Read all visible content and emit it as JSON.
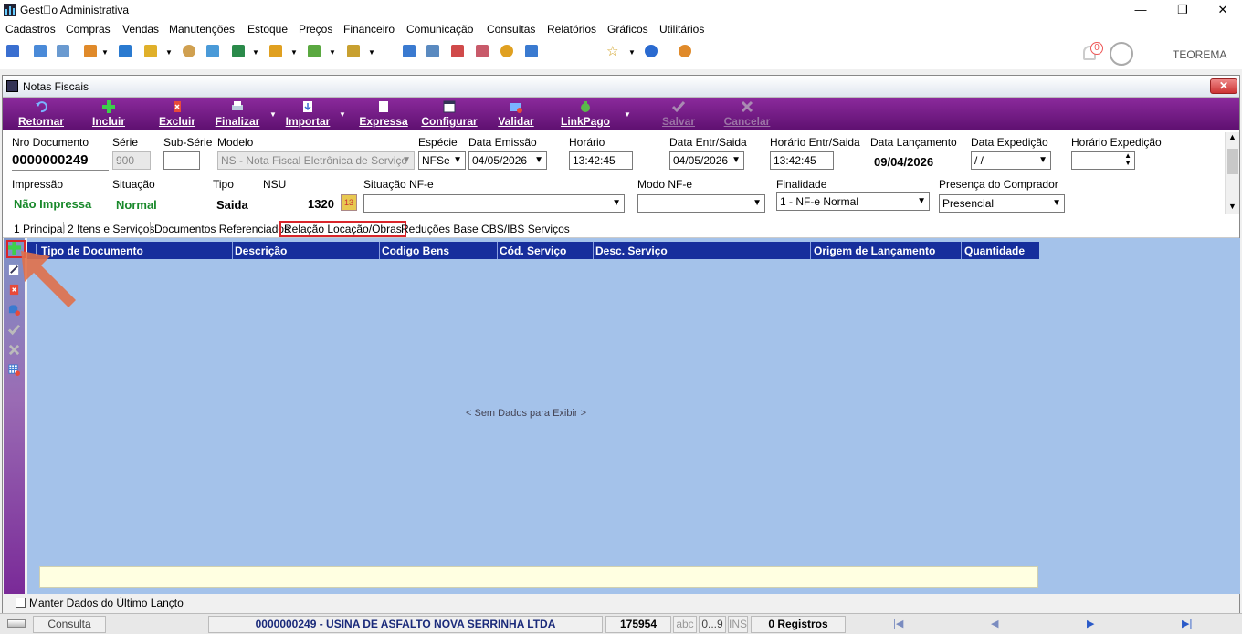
{
  "window": {
    "title": "Gest\u0000o Administrativa",
    "min": "—",
    "max": "❒",
    "close": "✕"
  },
  "menu": [
    "Cadastros",
    "Compras",
    "Vendas",
    "Manutenções",
    "Estoque",
    "Preços",
    "Financeiro",
    "Comunicação",
    "Consultas",
    "Relatórios",
    "Gráficos",
    "Utilitários"
  ],
  "header": {
    "notification_count": "0",
    "company": "TEOREMA"
  },
  "child": {
    "title": "Notas Fiscais",
    "close": "✕"
  },
  "actions": {
    "retornar": "Retornar",
    "incluir": "Incluir",
    "excluir": "Excluir",
    "finalizar": "Finalizar",
    "importar": "Importar",
    "expressa": "Expressa",
    "configurar": "Configurar",
    "validar": "Validar",
    "linkpago": "LinkPago",
    "salvar": "Salvar",
    "cancelar": "Cancelar"
  },
  "form": {
    "nro_label": "Nro Documento",
    "nro_value": "0000000249",
    "serie_label": "Série",
    "serie_value": "900",
    "subserie_label": "Sub-Série",
    "subserie_value": "",
    "modelo_label": "Modelo",
    "modelo_value": "NS - Nota Fiscal Eletrônica de Serviço",
    "especie_label": "Espécie",
    "especie_value": "NFSe",
    "emissao_label": "Data Emissão",
    "emissao_value": "04/05/2026",
    "horario_label": "Horário",
    "horario_value": "13:42:45",
    "entr_label": "Data Entr/Saida",
    "entr_value": "04/05/2026",
    "hentr_label": "Horário Entr/Saida",
    "hentr_value": "13:42:45",
    "lanc_label": "Data Lançamento",
    "lanc_value": "09/04/2026",
    "exped_label": "Data Expedição",
    "exped_value": " / /",
    "hexped_label": "Horário Expedição",
    "hexped_value": "",
    "impressao_label": "Impressão",
    "impressao_value": "Não Impressa",
    "situacao_label": "Situação",
    "situacao_value": "Normal",
    "tipo_label": "Tipo",
    "tipo_value": "Saida",
    "nsu_label": "NSU",
    "nsu_value": "1320",
    "sitnfe_label": "Situação NF-e",
    "sitnfe_value": "",
    "modonfe_label": "Modo NF-e",
    "modonfe_value": "",
    "finalidade_label": "Finalidade",
    "finalidade_value": "1 - NF-e Normal",
    "presenca_label": "Presença do Comprador",
    "presenca_value": "Presencial"
  },
  "tabs": [
    "1 Principal",
    "2 Itens e Serviços",
    "Documentos Referenciados",
    "Relação Locação/Obras",
    "Reduções Base CBS/IBS Serviços"
  ],
  "grid": {
    "columns": [
      "Tipo de Documento",
      "Descrição",
      "Codigo Bens",
      "Cód. Serviço",
      "Desc. Serviço",
      "Origem de Lançamento",
      "Quantidade"
    ],
    "empty": "< Sem Dados para Exibir >"
  },
  "manter": "Manter Dados do Último Lançto",
  "status": {
    "mode": "Consulta",
    "doc": "0000000249 - USINA DE ASFALTO NOVA SERRINHA LTDA",
    "code": "175954",
    "abc": "abc",
    "range": "0...9",
    "ins": "INS",
    "registros": "0 Registros"
  },
  "colors": {
    "accent": "#7a2a98",
    "grid_header": "#162e9c",
    "grid_bg": "#a4c2ea",
    "highlight": "#d9252a"
  }
}
